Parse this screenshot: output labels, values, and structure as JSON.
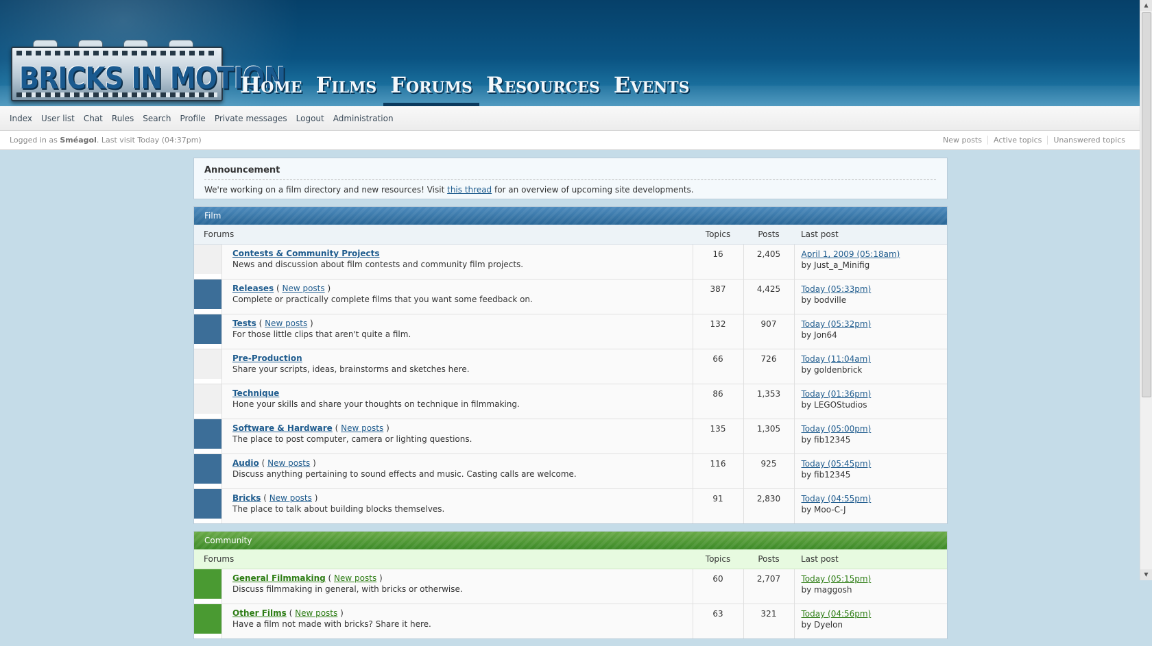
{
  "header": {
    "logo_text": "BRICKS IN MOTION",
    "nav": [
      {
        "label": "Home",
        "active": false
      },
      {
        "label": "Films",
        "active": false
      },
      {
        "label": "Forums",
        "active": true
      },
      {
        "label": "Resources",
        "active": false
      },
      {
        "label": "Events",
        "active": false
      }
    ]
  },
  "subnav": {
    "items": [
      "Index",
      "User list",
      "Chat",
      "Rules",
      "Search",
      "Profile",
      "Private messages",
      "Logout",
      "Administration"
    ]
  },
  "status": {
    "logged_prefix": "Logged in as ",
    "username": "Sméagol",
    "last_visit": ". Last visit Today (04:37pm)",
    "links": [
      "New posts",
      "Active topics",
      "Unanswered topics"
    ]
  },
  "announcement": {
    "title": "Announcement",
    "text_before": "We're working on a film directory and new resources! Visit ",
    "link_text": "this thread",
    "text_after": " for an overview of upcoming site developments."
  },
  "columns": {
    "forums": "Forums",
    "topics": "Topics",
    "posts": "Posts",
    "last_post": "Last post"
  },
  "categories": [
    {
      "name": "Film",
      "color": "#2a6797",
      "forums": [
        {
          "name": "Contests & Community Projects",
          "has_new": false,
          "new_label": "",
          "description": "News and discussion about film contests and community film projects.",
          "topics": "16",
          "posts": "2,405",
          "last_post": "April 1, 2009 (05:18am)",
          "last_by": "by Just_a_Minifig"
        },
        {
          "name": "Releases",
          "has_new": true,
          "new_label": "New posts",
          "description": "Complete or practically complete films that you want some feedback on.",
          "topics": "387",
          "posts": "4,425",
          "last_post": "Today (05:33pm)",
          "last_by": "by bodville"
        },
        {
          "name": "Tests",
          "has_new": true,
          "new_label": "New posts",
          "description": "For those little clips that aren't quite a film.",
          "topics": "132",
          "posts": "907",
          "last_post": "Today (05:32pm)",
          "last_by": "by Jon64"
        },
        {
          "name": "Pre-Production",
          "has_new": false,
          "new_label": "",
          "description": "Share your scripts, ideas, brainstorms and sketches here.",
          "topics": "66",
          "posts": "726",
          "last_post": "Today (11:04am)",
          "last_by": "by goldenbrick"
        },
        {
          "name": "Technique",
          "has_new": false,
          "new_label": "",
          "description": "Hone your skills and share your thoughts on technique in filmmaking.",
          "topics": "86",
          "posts": "1,353",
          "last_post": "Today (01:36pm)",
          "last_by": "by LEGOStudios"
        },
        {
          "name": "Software & Hardware",
          "has_new": true,
          "new_label": "New posts",
          "description": "The place to post computer, camera or lighting questions.",
          "topics": "135",
          "posts": "1,305",
          "last_post": "Today (05:00pm)",
          "last_by": "by fib12345"
        },
        {
          "name": "Audio",
          "has_new": true,
          "new_label": "New posts",
          "description": "Discuss anything pertaining to sound effects and music. Casting calls are welcome.",
          "topics": "116",
          "posts": "925",
          "last_post": "Today (05:45pm)",
          "last_by": "by fib12345"
        },
        {
          "name": "Bricks",
          "has_new": true,
          "new_label": "New posts",
          "description": "The place to talk about building blocks themselves.",
          "topics": "91",
          "posts": "2,830",
          "last_post": "Today (04:55pm)",
          "last_by": "by Moo-C-J"
        }
      ]
    },
    {
      "name": "Community",
      "color": "#3c8a27",
      "forums": [
        {
          "name": "General Filmmaking",
          "has_new": true,
          "new_label": "New posts",
          "description": "Discuss filmmaking in general, with bricks or otherwise.",
          "topics": "60",
          "posts": "2,707",
          "last_post": "Today (05:15pm)",
          "last_by": "by maggosh"
        },
        {
          "name": "Other Films",
          "has_new": true,
          "new_label": "New posts",
          "description": "Have a film not made with bricks? Share it here.",
          "topics": "63",
          "posts": "321",
          "last_post": "Today (04:56pm)",
          "last_by": "by Dyelon"
        }
      ]
    }
  ]
}
